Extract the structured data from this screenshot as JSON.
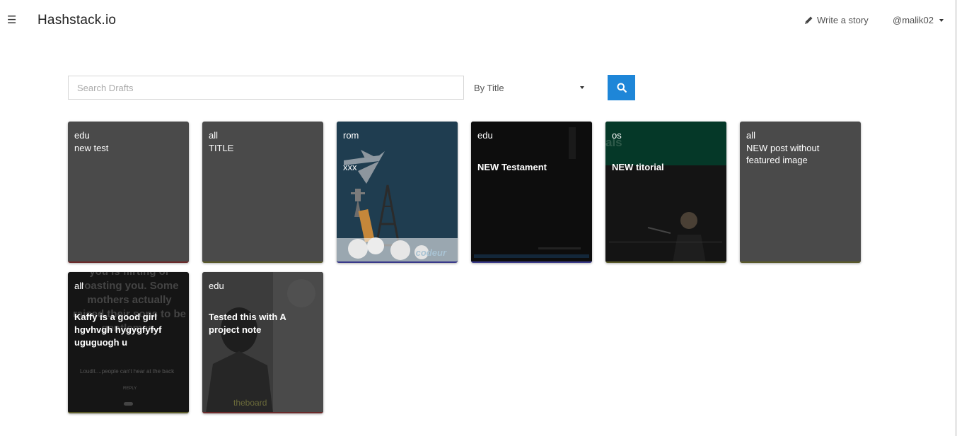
{
  "header": {
    "menu_icon": "hamburger-icon",
    "brand": "Hashstack.io",
    "write_label": "Write a story",
    "write_icon": "pencil-icon",
    "user": "@malik02"
  },
  "search": {
    "placeholder": "Search Drafts",
    "sort_selected": "By Title",
    "button_icon": "search-icon",
    "accent": "#1e86d8"
  },
  "cards": [
    {
      "tag": "edu",
      "title": "new test"
    },
    {
      "tag": "all",
      "title": "TITLE"
    },
    {
      "tag": "rom",
      "title": "xxx",
      "image_text": "codeur"
    },
    {
      "tag": "edu",
      "title": "NEW Testament"
    },
    {
      "tag": "os",
      "title": "NEW titorial",
      "image_text": "als"
    },
    {
      "tag": "all",
      "title": "NEW post without featured image"
    },
    {
      "tag": "all",
      "title": "Kaffy is a good girl hgvhvgh hygygfyfyf uguguogh u",
      "image_text": "you is flirting or roasting you. Some mothers actually raised their sons to be gentlemen.",
      "image_caption": "Loudit....people can't hear at the back",
      "image_reply": "REPLY"
    },
    {
      "tag": "edu",
      "title": "Tested this with A project note",
      "image_text": "theboard"
    }
  ]
}
